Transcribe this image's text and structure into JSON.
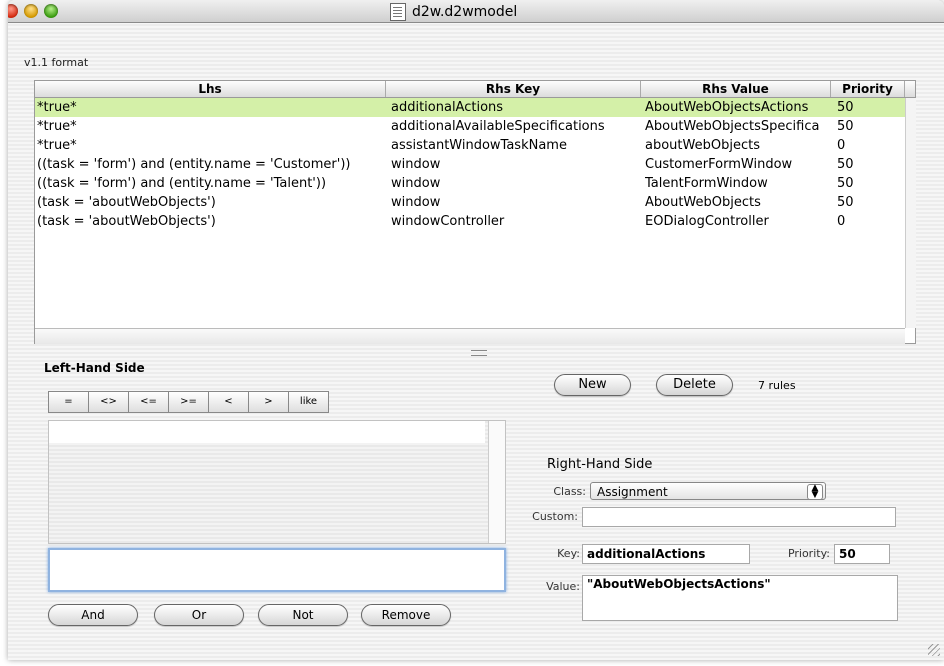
{
  "window": {
    "title": "d2w.d2wmodel"
  },
  "format_label": "v1.1   format",
  "table": {
    "headers": [
      "Lhs",
      "Rhs Key",
      "Rhs Value",
      "Priority"
    ],
    "rows": [
      {
        "lhs": "*true*",
        "key": "additionalActions",
        "value": "AboutWebObjectsActions",
        "priority": "50",
        "selected": true
      },
      {
        "lhs": "*true*",
        "key": "additionalAvailableSpecifications",
        "value": "AboutWebObjectsSpecifica",
        "priority": "50"
      },
      {
        "lhs": "*true*",
        "key": "assistantWindowTaskName",
        "value": "aboutWebObjects",
        "priority": "0"
      },
      {
        "lhs": "((task = 'form') and (entity.name = 'Customer'))",
        "key": "window",
        "value": "CustomerFormWindow",
        "priority": "50"
      },
      {
        "lhs": "((task = 'form') and (entity.name = 'Talent'))",
        "key": "window",
        "value": "TalentFormWindow",
        "priority": "50"
      },
      {
        "lhs": "(task = 'aboutWebObjects')",
        "key": "window",
        "value": "AboutWebObjects",
        "priority": "50"
      },
      {
        "lhs": "(task = 'aboutWebObjects')",
        "key": "windowController",
        "value": "EODialogController",
        "priority": "0"
      }
    ]
  },
  "lhs": {
    "label": "Left-Hand Side",
    "operators": [
      "=",
      "<>",
      "<=",
      ">=",
      "<",
      ">",
      "like"
    ],
    "buttons": {
      "and": "And",
      "or": "Or",
      "not": "Not",
      "remove": "Remove"
    }
  },
  "rules": {
    "new": "New",
    "delete": "Delete",
    "count": "7 rules"
  },
  "rhs": {
    "label": "Right-Hand Side",
    "class_label": "Class:",
    "class_value": "Assignment",
    "custom_label": "Custom:",
    "custom_value": "",
    "key_label": "Key:",
    "key_value": "additionalActions",
    "priority_label": "Priority:",
    "priority_value": "50",
    "value_label": "Value:",
    "value_value": "\"AboutWebObjectsActions\""
  },
  "colors": {
    "selected_row": "#d4f0a8",
    "focus_ring": "#8fb3e0"
  }
}
